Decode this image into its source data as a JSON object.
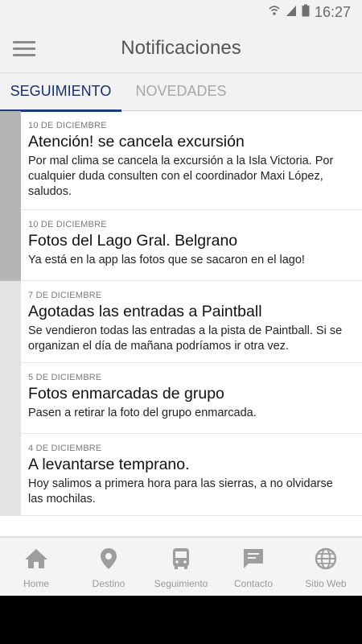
{
  "status_bar": {
    "time": "16:27",
    "icons": [
      "wifi-icon",
      "signal-icon",
      "battery-icon"
    ]
  },
  "header": {
    "title": "Notificaciones",
    "menu_icon": "menu-icon"
  },
  "tabs": [
    {
      "label": "SEGUIMIENTO",
      "active": true
    },
    {
      "label": "NOVEDADES",
      "active": false
    }
  ],
  "notifications": [
    {
      "date": "10 DE DICIEMBRE",
      "title": "Atención! se cancela excursión",
      "body": "Por mal clima se cancela la excursión a la Isla Victoria. Por cualquier duda consulten con el coordinador Maxi López, saludos.",
      "unread": true
    },
    {
      "date": "10 DE DICIEMBRE",
      "title": "Fotos del Lago Gral. Belgrano",
      "body": "Ya está en la app las fotos que se sacaron en el lago!",
      "unread": true
    },
    {
      "date": "7 DE DICIEMBRE",
      "title": "Agotadas las entradas a Paintball",
      "body": "Se vendieron todas las entradas a la pista de Paintball. Si se organizan el día de mañana podríamos ir otra vez.",
      "unread": false
    },
    {
      "date": "5 DE DICIEMBRE",
      "title": "Fotos enmarcadas de grupo",
      "body": "Pasen a retirar la foto del grupo enmarcada.",
      "unread": false
    },
    {
      "date": "4 DE DICIEMBRE",
      "title": "A levantarse temprano.",
      "body": "Hoy salimos a primera hora para las sierras, a no olvidarse las mochilas.",
      "unread": false
    }
  ],
  "bottom_nav": [
    {
      "label": "Home",
      "icon": "home-icon"
    },
    {
      "label": "Destino",
      "icon": "location-pin-icon"
    },
    {
      "label": "Seguimiento",
      "icon": "bus-icon"
    },
    {
      "label": "Contacto",
      "icon": "chat-icon"
    },
    {
      "label": "Sitio Web",
      "icon": "globe-icon"
    }
  ],
  "colors": {
    "accent": "#1b3a7f",
    "unread_bar": "#b5b5b5",
    "read_bar": "#e3e3e3",
    "nav_icon": "#9e9e9e"
  }
}
